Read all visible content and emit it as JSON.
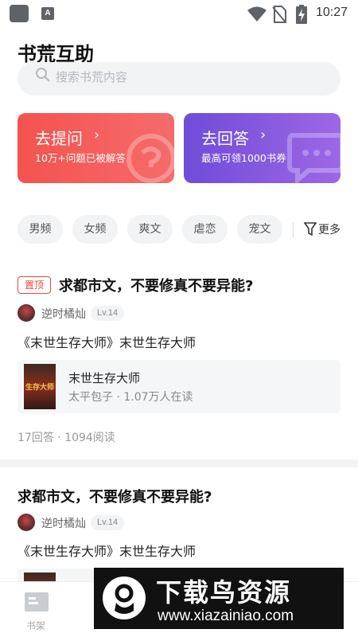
{
  "status_bar": {
    "time": "10:27",
    "app_badge": "A"
  },
  "page": {
    "title": "书荒互助"
  },
  "search": {
    "placeholder": "搜索书荒内容"
  },
  "actions": [
    {
      "title": "去提问",
      "subtitle": "10万+问题已被解答",
      "color": "#f4534f"
    },
    {
      "title": "去回答",
      "subtitle": "最高可领1000书券",
      "color": "#7f57de"
    }
  ],
  "categories": [
    "男频",
    "女频",
    "爽文",
    "虐恋",
    "宠文"
  ],
  "more_label": "更多",
  "posts": [
    {
      "pinned": true,
      "pin_label": "置顶",
      "title": "求都市文，不要修真不要异能?",
      "author": "逆时橘灿",
      "level": "Lv.14",
      "answer": "《末世生存大师》末世生存大师",
      "book": {
        "name": "末世生存大师",
        "meta": "太平包子 · 1.07万人在读",
        "cover_text": "生存大师"
      },
      "stats": "17回答 · 1094阅读"
    },
    {
      "pinned": false,
      "title": "求都市文，不要修真不要异能?",
      "author": "逆时橘灿",
      "level": "Lv.14",
      "answer": "《末世生存大师》末世生存大师"
    }
  ],
  "tabbar": {
    "bookshelf_label": "书架"
  },
  "watermark": {
    "main": "下载鸟资源",
    "url": "www.xiazainiao.com"
  },
  "colors": {
    "accent_red": "#e9463f",
    "accent_purple": "#7f57de",
    "chip_bg": "#f2f3f5"
  }
}
